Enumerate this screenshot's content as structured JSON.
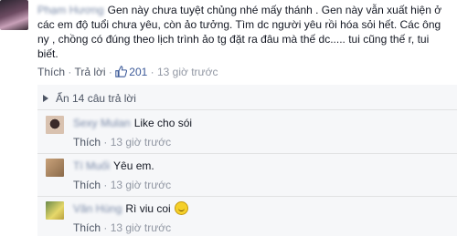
{
  "main_comment": {
    "author": "Phạm Hương",
    "text": "Gen này chưa tuyệt chủng nhé mấy thánh . Gen này vẫn xuất hiện ở các em độ tuổi chưa yêu, còn ảo tưởng. Tìm dc người yêu rồi hóa sỏi hết. Các ông ny , chồng có đúng theo lịch trình ảo tg đặt ra đâu mà thế dc..... tui cũng thế r, tui biết.",
    "actions": {
      "like": "Thích",
      "separator": "·",
      "reply": "Trả lời",
      "like_count": "201",
      "time": "13 giờ trước"
    }
  },
  "replies_toggle": "Ẩn 14 câu trả lời",
  "replies": [
    {
      "author": "Sexy Mulan",
      "text": "Like cho sói",
      "like": "Thích",
      "separator": "·",
      "time": "13 giờ trước"
    },
    {
      "author": "Tí Muối",
      "text": "Yêu em.",
      "like": "Thích",
      "separator": "·",
      "time": "13 giờ trước"
    },
    {
      "author": "Văn Hùng",
      "text": "Rì viu coi",
      "like": "Thích",
      "separator": "·",
      "time": "13 giờ trước"
    }
  ]
}
